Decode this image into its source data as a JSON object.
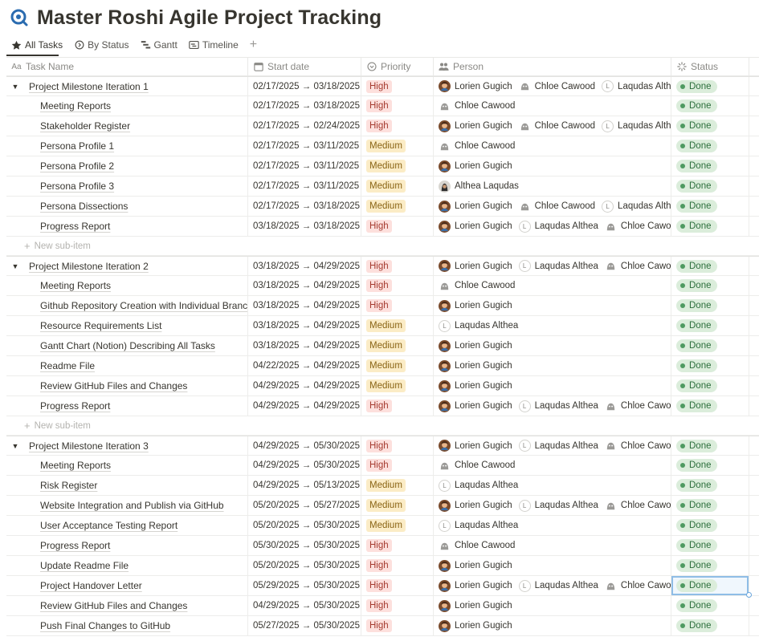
{
  "page": {
    "title": "Master Roshi Agile Project Tracking"
  },
  "tabs": [
    {
      "label": "All Tasks",
      "icon": "star-icon",
      "active": true
    },
    {
      "label": "By Status",
      "icon": "status-circle-icon"
    },
    {
      "label": "Gantt",
      "icon": "gantt-icon"
    },
    {
      "label": "Timeline",
      "icon": "timeline-icon"
    }
  ],
  "tab_add_label": "+",
  "columns": {
    "task": {
      "icon_text": "Aa",
      "label": "Task Name"
    },
    "date": {
      "icon": "calendar-icon",
      "label": "Start date"
    },
    "priority": {
      "icon": "select-circle-icon",
      "label": "Priority"
    },
    "person": {
      "icon": "people-icon",
      "label": "Person"
    },
    "status": {
      "icon": "status-spinner-icon",
      "label": "Status"
    }
  },
  "new_sub_item": "New sub-item",
  "groups": [
    {
      "parent": {
        "name": "Project Milestone Iteration 1",
        "date": "02/17/2025 → 03/18/2025",
        "priority": "High",
        "people": [
          "Lorien Gugich",
          "Chloe Cawood",
          "Laqudas Althea"
        ],
        "status": "Done"
      },
      "children": [
        {
          "name": "Meeting Reports",
          "date": "02/17/2025 → 03/18/2025",
          "priority": "High",
          "people": [
            "Chloe Cawood"
          ],
          "status": "Done"
        },
        {
          "name": "Stakeholder Register",
          "date": "02/17/2025 → 02/24/2025",
          "priority": "High",
          "people": [
            "Lorien Gugich",
            "Chloe Cawood",
            "Laqudas Althea"
          ],
          "status": "Done"
        },
        {
          "name": "Persona Profile 1",
          "date": "02/17/2025 → 03/11/2025",
          "priority": "Medium",
          "people": [
            "Chloe Cawood"
          ],
          "status": "Done"
        },
        {
          "name": "Persona Profile 2",
          "date": "02/17/2025 → 03/11/2025",
          "priority": "Medium",
          "people": [
            "Lorien Gugich"
          ],
          "status": "Done"
        },
        {
          "name": "Persona Profile 3",
          "date": "02/17/2025 → 03/11/2025",
          "priority": "Medium",
          "people": [
            "Althea Laqudas"
          ],
          "status": "Done"
        },
        {
          "name": "Persona Dissections",
          "date": "02/17/2025 → 03/18/2025",
          "priority": "Medium",
          "people": [
            "Lorien Gugich",
            "Chloe Cawood",
            "Laqudas Althea"
          ],
          "status": "Done"
        },
        {
          "name": "Progress Report",
          "date": "03/18/2025 → 03/18/2025",
          "priority": "High",
          "people": [
            "Lorien Gugich",
            "Laqudas Althea",
            "Chloe Cawood"
          ],
          "status": "Done"
        }
      ],
      "show_new_sub": true
    },
    {
      "parent": {
        "name": "Project Milestone Iteration 2",
        "date": "03/18/2025 → 04/29/2025",
        "priority": "High",
        "people": [
          "Lorien Gugich",
          "Laqudas Althea",
          "Chloe Cawood"
        ],
        "status": "Done"
      },
      "children": [
        {
          "name": "Meeting Reports",
          "date": "03/18/2025 → 04/29/2025",
          "priority": "High",
          "people": [
            "Chloe Cawood"
          ],
          "status": "Done"
        },
        {
          "name": "Github Repository Creation with Individual Branches",
          "date": "03/18/2025 → 04/29/2025",
          "priority": "High",
          "people": [
            "Lorien Gugich"
          ],
          "status": "Done"
        },
        {
          "name": "Resource Requirements List",
          "date": "03/18/2025 → 04/29/2025",
          "priority": "Medium",
          "people": [
            "Laqudas Althea"
          ],
          "status": "Done"
        },
        {
          "name": "Gantt Chart (Notion) Describing All Tasks",
          "date": "03/18/2025 → 04/29/2025",
          "priority": "Medium",
          "people": [
            "Lorien Gugich"
          ],
          "status": "Done"
        },
        {
          "name": "Readme File",
          "date": "04/22/2025 → 04/29/2025",
          "priority": "Medium",
          "people": [
            "Lorien Gugich"
          ],
          "status": "Done"
        },
        {
          "name": "Review GitHub Files and Changes",
          "date": "04/29/2025 → 04/29/2025",
          "priority": "Medium",
          "people": [
            "Lorien Gugich"
          ],
          "status": "Done"
        },
        {
          "name": "Progress Report",
          "date": "04/29/2025 → 04/29/2025",
          "priority": "High",
          "people": [
            "Lorien Gugich",
            "Laqudas Althea",
            "Chloe Cawood"
          ],
          "status": "Done"
        }
      ],
      "show_new_sub": true
    },
    {
      "parent": {
        "name": "Project Milestone Iteration 3",
        "date": "04/29/2025 → 05/30/2025",
        "priority": "High",
        "people": [
          "Lorien Gugich",
          "Laqudas Althea",
          "Chloe Cawood"
        ],
        "status": "Done"
      },
      "children": [
        {
          "name": "Meeting Reports",
          "date": "04/29/2025 → 05/30/2025",
          "priority": "High",
          "people": [
            "Chloe Cawood"
          ],
          "status": "Done"
        },
        {
          "name": "Risk Register",
          "date": "04/29/2025 → 05/13/2025",
          "priority": "Medium",
          "people": [
            "Laqudas Althea"
          ],
          "status": "Done"
        },
        {
          "name": "Website Integration and Publish via GitHub",
          "date": "05/20/2025 → 05/27/2025",
          "priority": "Medium",
          "people": [
            "Lorien Gugich",
            "Laqudas Althea",
            "Chloe Cawood"
          ],
          "status": "Done"
        },
        {
          "name": "User Acceptance Testing Report",
          "date": "05/20/2025 → 05/30/2025",
          "priority": "Medium",
          "people": [
            "Laqudas Althea"
          ],
          "status": "Done"
        },
        {
          "name": "Progress Report",
          "date": "05/30/2025 → 05/30/2025",
          "priority": "High",
          "people": [
            "Chloe Cawood"
          ],
          "status": "Done"
        },
        {
          "name": "Update Readme File",
          "date": "05/20/2025 → 05/30/2025",
          "priority": "High",
          "people": [
            "Lorien Gugich"
          ],
          "status": "Done"
        },
        {
          "name": "Project Handover Letter",
          "date": "05/29/2025 → 05/30/2025",
          "priority": "High",
          "people": [
            "Lorien Gugich",
            "Laqudas Althea",
            "Chloe Cawood"
          ],
          "status": "Done",
          "selected": true
        },
        {
          "name": "Review GitHub Files and Changes",
          "date": "04/29/2025 → 05/30/2025",
          "priority": "High",
          "people": [
            "Lorien Gugich"
          ],
          "status": "Done"
        },
        {
          "name": "Push Final Changes to GitHub",
          "date": "05/27/2025 → 05/30/2025",
          "priority": "High",
          "people": [
            "Lorien Gugich"
          ],
          "status": "Done"
        }
      ],
      "show_new_sub": false
    }
  ],
  "colors": {
    "high_bg": "#fde0dd",
    "high_fg": "#a53a2f",
    "medium_bg": "#fbecc6",
    "medium_fg": "#8a6414",
    "done_bg": "#dbeddb",
    "done_dot": "#4f9a61"
  }
}
